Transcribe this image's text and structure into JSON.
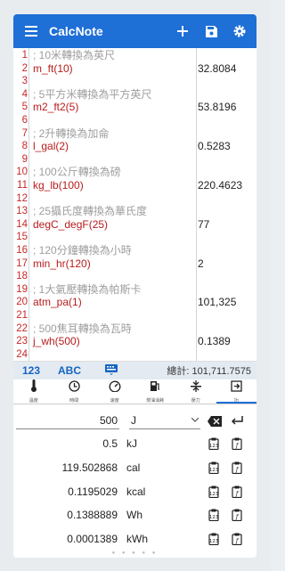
{
  "app": {
    "title": "CalcNote"
  },
  "lines": [
    {
      "n": "1",
      "code": "; 10米轉換為英尺",
      "comment": true,
      "res": ""
    },
    {
      "n": "2",
      "code": "m_ft(10)",
      "comment": false,
      "res": "32.8084"
    },
    {
      "n": "3",
      "code": "",
      "comment": false,
      "res": ""
    },
    {
      "n": "4",
      "code": "; 5平方米轉換為平方英尺",
      "comment": true,
      "res": ""
    },
    {
      "n": "5",
      "code": "m2_ft2(5)",
      "comment": false,
      "res": "53.8196"
    },
    {
      "n": "6",
      "code": "",
      "comment": false,
      "res": ""
    },
    {
      "n": "7",
      "code": "; 2升轉換為加侖",
      "comment": true,
      "res": ""
    },
    {
      "n": "8",
      "code": "l_gal(2)",
      "comment": false,
      "res": "0.5283"
    },
    {
      "n": "9",
      "code": "",
      "comment": false,
      "res": ""
    },
    {
      "n": "10",
      "code": "; 100公斤轉換為磅",
      "comment": true,
      "res": ""
    },
    {
      "n": "11",
      "code": "kg_lb(100)",
      "comment": false,
      "res": "220.4623"
    },
    {
      "n": "12",
      "code": "",
      "comment": false,
      "res": ""
    },
    {
      "n": "13",
      "code": "; 25攝氏度轉換為華氏度",
      "comment": true,
      "res": ""
    },
    {
      "n": "14",
      "code": "degC_degF(25)",
      "comment": false,
      "res": "77"
    },
    {
      "n": "15",
      "code": "",
      "comment": false,
      "res": ""
    },
    {
      "n": "16",
      "code": "; 120分鐘轉換為小時",
      "comment": true,
      "res": ""
    },
    {
      "n": "17",
      "code": "min_hr(120)",
      "comment": false,
      "res": "2"
    },
    {
      "n": "18",
      "code": "",
      "comment": false,
      "res": ""
    },
    {
      "n": "19",
      "code": "; 1大氣壓轉換為帕斯卡",
      "comment": true,
      "res": ""
    },
    {
      "n": "20",
      "code": "atm_pa(1)",
      "comment": false,
      "res": "101,325"
    },
    {
      "n": "21",
      "code": "",
      "comment": false,
      "res": ""
    },
    {
      "n": "22",
      "code": "; 500焦耳轉換為瓦時",
      "comment": true,
      "res": ""
    },
    {
      "n": "23",
      "code": "j_wh(500)",
      "comment": false,
      "res": "0.1389"
    },
    {
      "n": "24",
      "code": "",
      "comment": false,
      "res": ""
    }
  ],
  "modebar": {
    "num_mode": "123",
    "abc_mode": "ABC",
    "total": "總計: 101,711.7575"
  },
  "tabs": [
    {
      "label": "溫度",
      "icon": "thermometer-icon"
    },
    {
      "label": "時間",
      "icon": "clock-icon"
    },
    {
      "label": "速度",
      "icon": "speedometer-icon"
    },
    {
      "label": "燃油消耗",
      "icon": "fuel-icon"
    },
    {
      "label": "壓力",
      "icon": "pressure-icon"
    },
    {
      "label": "功",
      "icon": "energy-icon"
    }
  ],
  "converter": {
    "input_value": "500",
    "input_unit": "J",
    "rows": [
      {
        "value": "0.5",
        "unit": "kJ"
      },
      {
        "value": "119.502868",
        "unit": "cal"
      },
      {
        "value": "0.1195029",
        "unit": "kcal"
      },
      {
        "value": "0.1388889",
        "unit": "Wh"
      },
      {
        "value": "0.0001389",
        "unit": "kWh"
      }
    ]
  },
  "colors": {
    "primary": "#1e6fd6",
    "code": "#b71c1c",
    "comment": "#9e9e9e"
  }
}
